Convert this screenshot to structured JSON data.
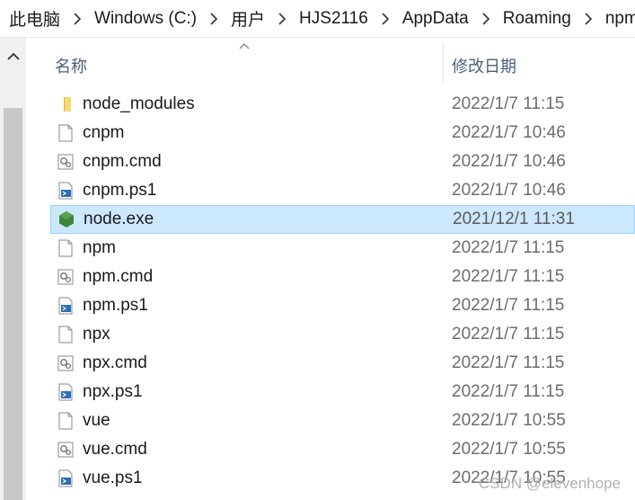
{
  "breadcrumb": {
    "items": [
      "此电脑",
      "Windows (C:)",
      "用户",
      "HJS2116",
      "AppData",
      "Roaming",
      "npm"
    ]
  },
  "columns": {
    "name": "名称",
    "date": "修改日期"
  },
  "files": [
    {
      "name": "node_modules",
      "date": "2022/1/7 11:15",
      "icon": "folder-icon"
    },
    {
      "name": "cnpm",
      "date": "2022/1/7 10:46",
      "icon": "blank-file-icon"
    },
    {
      "name": "cnpm.cmd",
      "date": "2022/1/7 10:46",
      "icon": "cmd-file-icon"
    },
    {
      "name": "cnpm.ps1",
      "date": "2022/1/7 10:46",
      "icon": "powershell-file-icon"
    },
    {
      "name": "node.exe",
      "date": "2021/12/1 11:31",
      "icon": "nodejs-icon",
      "selected": true
    },
    {
      "name": "npm",
      "date": "2022/1/7 11:15",
      "icon": "blank-file-icon"
    },
    {
      "name": "npm.cmd",
      "date": "2022/1/7 11:15",
      "icon": "cmd-file-icon"
    },
    {
      "name": "npm.ps1",
      "date": "2022/1/7 11:15",
      "icon": "powershell-file-icon"
    },
    {
      "name": "npx",
      "date": "2022/1/7 11:15",
      "icon": "blank-file-icon"
    },
    {
      "name": "npx.cmd",
      "date": "2022/1/7 11:15",
      "icon": "cmd-file-icon"
    },
    {
      "name": "npx.ps1",
      "date": "2022/1/7 11:15",
      "icon": "powershell-file-icon"
    },
    {
      "name": "vue",
      "date": "2022/1/7 10:55",
      "icon": "blank-file-icon"
    },
    {
      "name": "vue.cmd",
      "date": "2022/1/7 10:55",
      "icon": "cmd-file-icon"
    },
    {
      "name": "vue.ps1",
      "date": "2022/1/7 10:55",
      "icon": "powershell-file-icon"
    }
  ],
  "colors": {
    "selection_bg": "#cce8ff",
    "selection_border": "#99d1ff",
    "folder": "#f8d775",
    "nodejs": "#3c873a"
  },
  "watermark": "CSDN @elevenhope"
}
